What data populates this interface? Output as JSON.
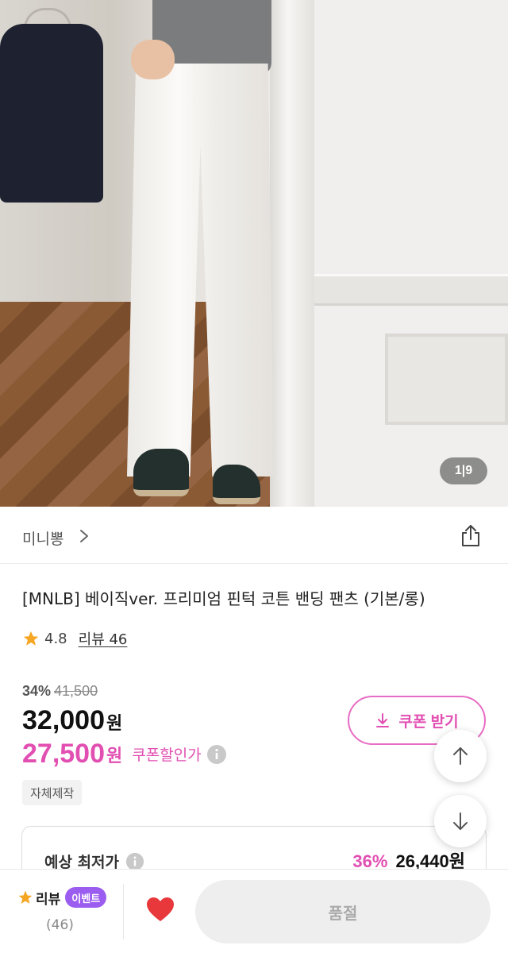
{
  "product_image": {
    "alt": "white banding pants product photo",
    "counter": "1|9"
  },
  "brand": {
    "name": "미니뽕"
  },
  "title": "[MNLB] 베이직ver. 프리미엄 핀턱 코튼 밴딩 팬츠 (기본/롱)",
  "rating": {
    "score": "4.8",
    "review_link": "리뷰 46"
  },
  "pricing": {
    "discount_rate": "34%",
    "original_price": "41,500",
    "price": "32,000",
    "price_unit": "원",
    "coupon_price": "27,500",
    "coupon_unit": "원",
    "coupon_label": "쿠폰할인가",
    "coupon_button": "쿠폰 받기"
  },
  "tag": "자체제작",
  "lowest": {
    "label": "예상 최저가",
    "rate": "36%",
    "price": "26,440원"
  },
  "bottom_bar": {
    "review_label": "리뷰",
    "event_badge": "이벤트",
    "review_count": "(46)",
    "soldout_button": "품절"
  },
  "colors": {
    "accent_pink": "#e24fb2",
    "event_purple": "#9b5cf0",
    "star": "#f5a623",
    "heart": "#e8383b"
  },
  "icons": [
    "chevron-right-icon",
    "share-icon",
    "star-icon",
    "info-icon",
    "download-icon",
    "arrow-up-icon",
    "arrow-down-icon",
    "heart-icon"
  ]
}
